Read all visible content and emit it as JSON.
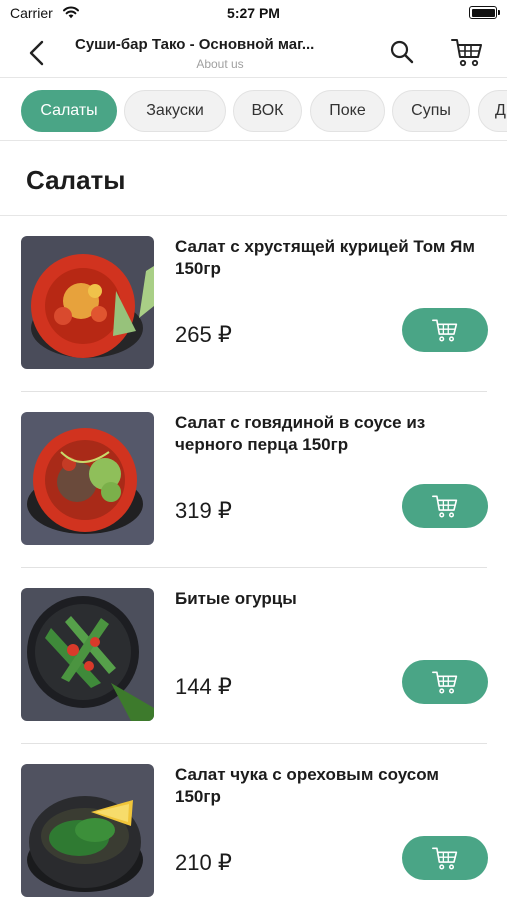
{
  "status_bar": {
    "carrier": "Carrier",
    "time": "5:27 PM"
  },
  "header": {
    "title": "Суши-бар Тако - Основной маг...",
    "subtitle": "About us"
  },
  "tabs": [
    {
      "label": "Салаты",
      "active": true
    },
    {
      "label": "Закуски",
      "active": false
    },
    {
      "label": "ВОК",
      "active": false
    },
    {
      "label": "Поке",
      "active": false
    },
    {
      "label": "Супы",
      "active": false
    },
    {
      "label": "Д",
      "active": false
    }
  ],
  "section": {
    "title": "Салаты"
  },
  "products": [
    {
      "name": "Салат с хрустящей курицей Том Ям 150гр",
      "price": "265 ₽"
    },
    {
      "name": "Салат с говядиной в соусе из черного перца 150гр",
      "price": "319 ₽"
    },
    {
      "name": "Битые огурцы",
      "price": "144 ₽"
    },
    {
      "name": "Салат чука с ореховым соусом 150гр",
      "price": "210 ₽"
    }
  ],
  "colors": {
    "accent": "#4aa586",
    "background": "#ffffff",
    "divider": "#e6e6e6"
  },
  "icons": {
    "back": "chevron-left-icon",
    "search": "search-icon",
    "cart": "cart-icon",
    "wifi": "wifi-icon",
    "battery": "battery-icon"
  }
}
